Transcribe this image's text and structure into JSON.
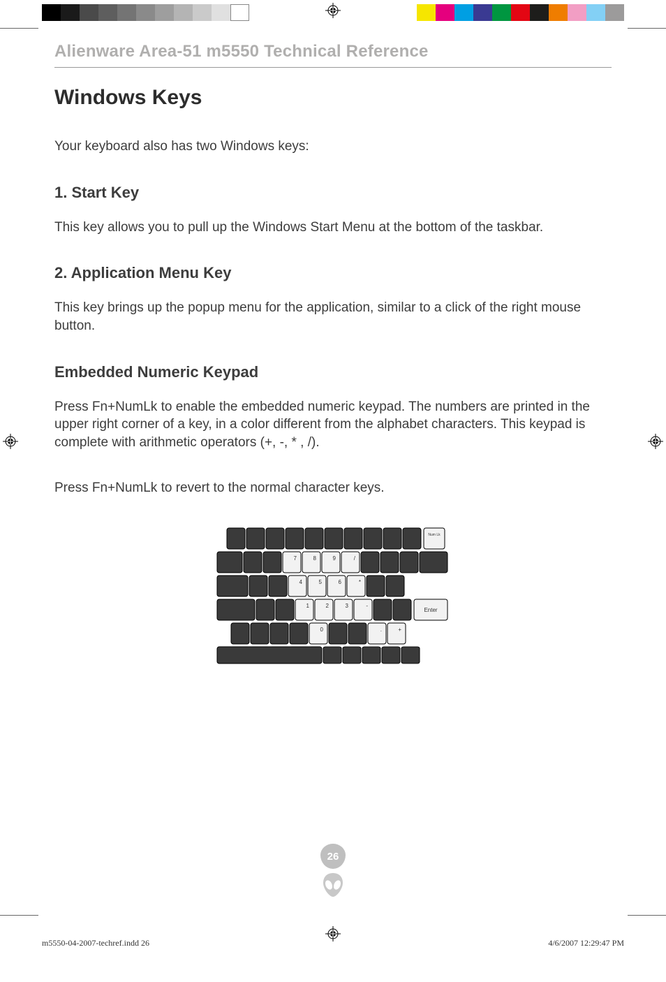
{
  "colorbars": {
    "left": [
      "#000000",
      "#1a1a1a",
      "#4a4a4a",
      "#5e5e5e",
      "#747474",
      "#8a8a8a",
      "#9e9e9e",
      "#b4b4b4",
      "#cacaca",
      "#e0e0e0",
      "outline"
    ],
    "right": [
      "#f6e600",
      "#e5007e",
      "#009fe3",
      "#3a3a92",
      "#009640",
      "#e30613",
      "#1d1d1b",
      "#ef7d00",
      "#f29ec4",
      "#83d0f5",
      "#9c9b9b"
    ]
  },
  "header": {
    "running": "Alienware Area-51 m5550 Technical Reference"
  },
  "title": "Windows Keys",
  "intro": "Your keyboard also has two Windows keys:",
  "sections": [
    {
      "heading": "1. Start Key",
      "paras": [
        "This key allows you to pull up the Windows Start Menu at the bottom of the taskbar."
      ]
    },
    {
      "heading": "2. Application Menu Key",
      "paras": [
        "This key brings up the popup menu for the application, similar to a click of the right mouse button."
      ]
    },
    {
      "heading": "Embedded Numeric Keypad",
      "paras": [
        "Press Fn+NumLk to enable the embedded numeric keypad. The numbers are printed in the upper right corner of a key, in a color different from the alphabet characters. This keypad is complete with arithmetic operators (+, -, * , /).",
        "Press Fn+NumLk to revert to the normal character keys."
      ]
    }
  ],
  "keyboard": {
    "numlk": "Num Lk",
    "enter": "Enter",
    "row1": [
      "7",
      "8",
      "9",
      "/"
    ],
    "row2": [
      "4",
      "5",
      "6",
      "*"
    ],
    "row3": [
      "1",
      "2",
      "3",
      "-"
    ],
    "row4_center": "0",
    "row4_right": [
      ".",
      "+"
    ]
  },
  "page_number": "26",
  "imposition": {
    "file": "m5550-04-2007-techref.indd   26",
    "stamp": "4/6/2007   12:29:47 PM"
  }
}
